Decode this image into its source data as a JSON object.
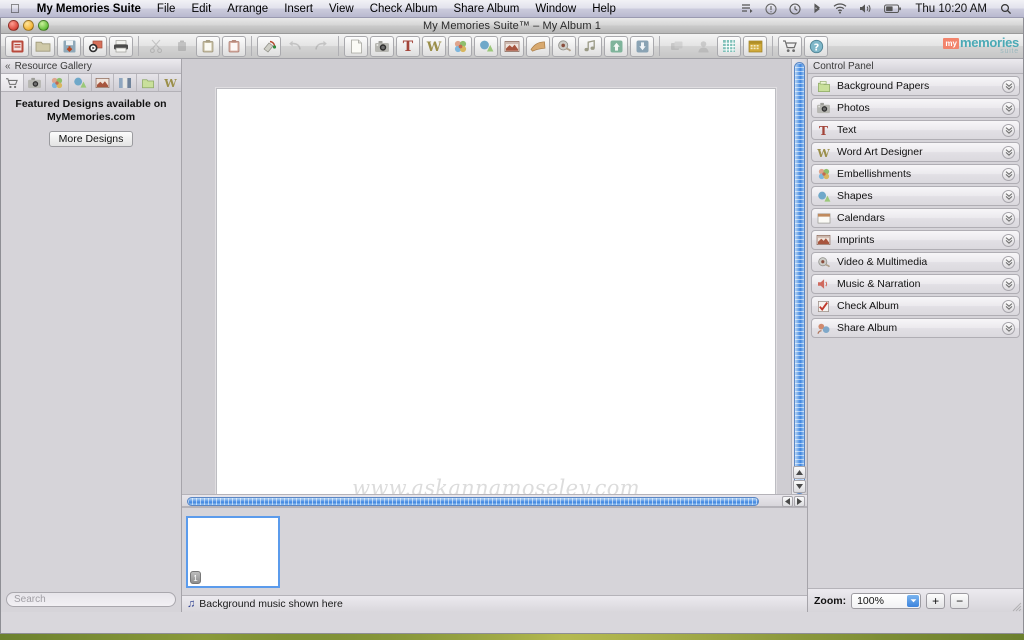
{
  "menubar": {
    "apple_icon": "apple-icon",
    "app_name": "My Memories Suite",
    "items": [
      "File",
      "Edit",
      "Arrange",
      "Insert",
      "View",
      "Check Album",
      "Share Album",
      "Window",
      "Help"
    ],
    "status_icons": [
      "airplay-icon",
      "alert-icon",
      "timemachine-icon",
      "bluetooth-icon",
      "wifi-icon",
      "volume-icon",
      "battery-icon"
    ],
    "clock": "Thu 10:20 AM",
    "search_icon": "spotlight-search-icon"
  },
  "window": {
    "title": "My Memories Suite™ – My Album 1",
    "traffic_lights": [
      "close-button",
      "minimize-button",
      "zoom-button"
    ]
  },
  "toolbar": {
    "groups": [
      [
        "new-project-icon",
        "open-folder-icon",
        "save-icon",
        "publish-icon",
        "print-icon"
      ],
      [
        "cut-icon",
        "copy-icon",
        "paste-icon",
        "duplicate-icon"
      ],
      [
        "format-painter-icon",
        "undo-icon",
        "redo-icon"
      ],
      [
        "blank-page-icon",
        "photo-icon",
        "text-icon",
        "word-art-icon",
        "embellishment-icon",
        "shape-icon",
        "imprint-icon",
        "page-curl-icon",
        "video-icon",
        "music-icon",
        "upload-icon",
        "download-icon"
      ],
      [
        "group-icon",
        "person-icon",
        "grid-icon",
        "calendar-icon"
      ],
      [
        "cart-icon",
        "help-icon"
      ]
    ],
    "logo": {
      "badge": "my",
      "name": "memories",
      "sub": "suite"
    }
  },
  "resource_gallery": {
    "collapse_icon": "chevron-double-left-icon",
    "title": "Resource Gallery",
    "tabs": [
      "store-cart-icon",
      "photos-icon",
      "embellishments-icon",
      "shapes-icon",
      "imprints-icon",
      "papers-bars-icon",
      "background-papers-icon",
      "word-art-icon"
    ],
    "featured_line1": "Featured Designs available on",
    "featured_line2": "MyMemories.com",
    "more_designs_label": "More Designs",
    "search_placeholder": "Search"
  },
  "canvas": {
    "watermark": "www.askannamoseley.com",
    "page_thumbnail_number": "1"
  },
  "statusbar": {
    "music_icon": "music-note-icon",
    "text": "Background music shown here"
  },
  "control_panel": {
    "title": "Control Panel",
    "items": [
      {
        "label": "Background Papers",
        "icon": "background-papers-icon",
        "disclosure": "chevron-double-down-icon"
      },
      {
        "label": "Photos",
        "icon": "photos-icon",
        "disclosure": "chevron-double-down-icon"
      },
      {
        "label": "Text",
        "icon": "text-icon",
        "disclosure": "chevron-double-down-icon"
      },
      {
        "label": "Word Art Designer",
        "icon": "word-art-icon",
        "disclosure": "chevron-double-down-icon"
      },
      {
        "label": "Embellishments",
        "icon": "embellishments-icon",
        "disclosure": "chevron-double-down-icon"
      },
      {
        "label": "Shapes",
        "icon": "shapes-icon",
        "disclosure": "chevron-double-down-icon"
      },
      {
        "label": "Calendars",
        "icon": "calendars-icon",
        "disclosure": "chevron-double-down-icon"
      },
      {
        "label": "Imprints",
        "icon": "imprints-icon",
        "disclosure": "chevron-double-down-icon"
      },
      {
        "label": "Video & Multimedia",
        "icon": "video-multimedia-icon",
        "disclosure": "chevron-double-down-icon"
      },
      {
        "label": "Music & Narration",
        "icon": "music-narration-icon",
        "disclosure": "chevron-double-down-icon"
      },
      {
        "label": "Check Album",
        "icon": "check-album-icon",
        "disclosure": "chevron-double-down-icon"
      },
      {
        "label": "Share Album",
        "icon": "share-album-icon",
        "disclosure": "chevron-double-down-icon"
      }
    ]
  },
  "zoom_bar": {
    "label": "Zoom:",
    "value": "100%",
    "zoom_in_label": "+",
    "zoom_out_label": "−"
  },
  "colors": {
    "accent_blue": "#3f86e0",
    "selection_blue": "#5b9bec",
    "logo_orange": "#f2846c",
    "logo_teal": "#4aa9b5",
    "window_gray": "#d6d4d9"
  }
}
